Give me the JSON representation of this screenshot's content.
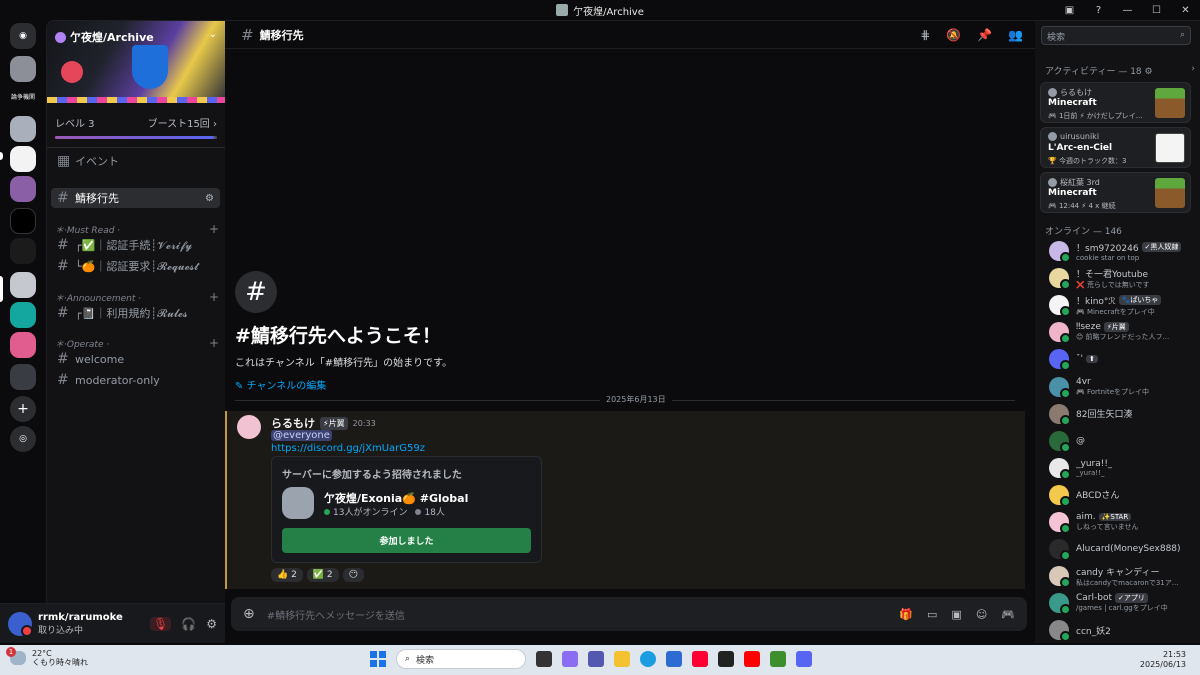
{
  "window": {
    "title": "亇夜煌/Archive",
    "controls": [
      "▣",
      "?",
      "—",
      "☐",
      "✕"
    ]
  },
  "rail": {
    "servers": [
      {
        "label": "Discord"
      },
      {
        "label": "論争機関"
      }
    ]
  },
  "sidebar": {
    "server_name": "亇夜煌/Archive",
    "level": "レベル 3",
    "boost": "ブースト15回",
    "events": "イベント",
    "active_channel": "鯖移行先",
    "cat1": "＊‧Must Read ‧",
    "ch_verify": "┌✅｜認証手続┊𝓥𝓮𝓻𝓲𝓯𝔂",
    "ch_request": "└🍊｜認証要求┊𝓡𝓮𝓺𝓾𝓮𝓼𝓽",
    "cat2": "＊‧Announcement ‧",
    "ch_rules": "┌📓｜利用規約┊𝓡𝓾𝓵𝓮𝓼",
    "cat3": "＊‧Operate ‧",
    "ch_welcome": "welcome",
    "ch_mod": "moderator-only"
  },
  "user": {
    "name": "rrmk/rarumoke",
    "status": "取り込み中"
  },
  "header": {
    "channel": "鯖移行先"
  },
  "welcome": {
    "title": "#鯖移行先へようこそ！",
    "sub": "これはチャンネル「#鯖移行先」の始まりです。",
    "edit": "✎ チャンネルの編集"
  },
  "date": "2025年6月13日",
  "message": {
    "author": "らるもけ",
    "tag": "⚡片翼",
    "time": "20:33",
    "mention": "@everyone",
    "link": "https://discord.gg/jXmUarG59z",
    "embed": {
      "title": "サーバーに参加するよう招待されました",
      "server": "亇夜煌/Exonia🍊 #Global",
      "online": "13人がオンライン",
      "members": "18人",
      "button": "参加しました"
    },
    "reactions": [
      "👍 2",
      "✅ 2",
      "😶"
    ]
  },
  "composer": {
    "placeholder": "#鯖移行先へメッセージを送信"
  },
  "right": {
    "search": "検索",
    "activity_title": "アクティビティー — 18 ⚙",
    "cards": [
      {
        "user": "らるもけ",
        "game": "Minecraft",
        "detail": "🎮 1日前 ⚡ かけだしプレイ..."
      },
      {
        "user": "uirusuniki",
        "game": "L'Arc-en-Ciel",
        "detail": "🏆 今週のトラック数：3"
      },
      {
        "user": "桜紅葉 3rd",
        "game": "Minecraft",
        "detail": "🎮 12:44 ⚡ 4 x 継続"
      }
    ],
    "online_title": "オンライン — 146",
    "members": [
      {
        "name": "！sm9720246",
        "badge": "✓黒人奴隷",
        "sub": "cookie star on top"
      },
      {
        "name": "！そ一君Youtube",
        "badge": "",
        "sub": "❌ 荒らしでは無いです"
      },
      {
        "name": "！kino°ℛ",
        "badge": "🐾ぱいちゃ",
        "sub": "🎮 Minecraftをプレイ中"
      },
      {
        "name": "‼seze",
        "badge": "⚡片翼",
        "sub": "😊 前略フレンドだった人フ..."
      },
      {
        "name": "ˇ'",
        "badge": "⬆",
        "sub": ""
      },
      {
        "name": "4vr",
        "badge": "",
        "sub": "🎮 Fortniteをプレイ中"
      },
      {
        "name": "82回生矢口湊",
        "badge": "",
        "sub": ""
      },
      {
        "name": "@",
        "badge": "",
        "sub": ""
      },
      {
        "name": "_yura!!_",
        "badge": "",
        "sub": "_yura!!_"
      },
      {
        "name": "ABCDさん",
        "badge": "",
        "sub": ""
      },
      {
        "name": "aim.",
        "badge": "✨STAR",
        "sub": "しねって言いません"
      },
      {
        "name": "Alucard(MoneySex888)",
        "badge": "",
        "sub": ""
      },
      {
        "name": "candy キャンディー",
        "badge": "",
        "sub": "私はcandyでmacaronで31ア..."
      },
      {
        "name": "Carl-bot",
        "badge": "✓アプリ",
        "sub": "/games | carl.ggをプレイ中"
      },
      {
        "name": "ccn_妖2",
        "badge": "",
        "sub": ""
      }
    ]
  },
  "taskbar": {
    "temp": "22°C",
    "weather": "くもり時々晴れ",
    "search": "検索",
    "time": "21:53",
    "date": "2025/06/13"
  },
  "colors": {
    "accent": "#5865f2",
    "green": "#248046",
    "online": "#23a55a",
    "dnd": "#f23f43"
  }
}
